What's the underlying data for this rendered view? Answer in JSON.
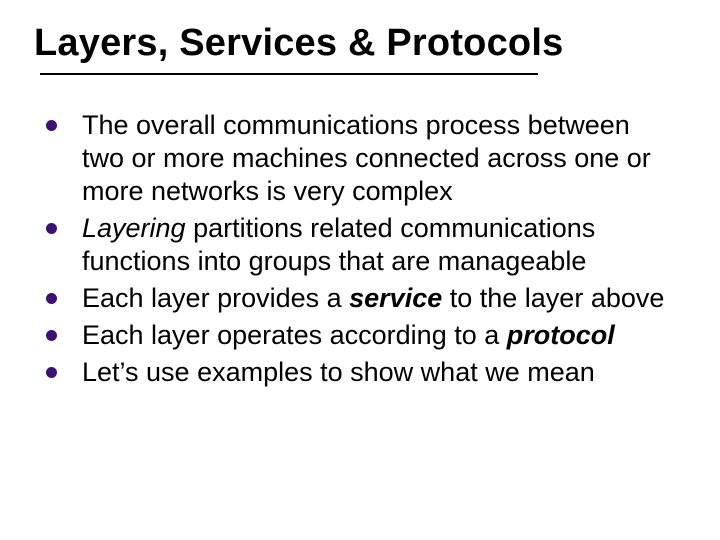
{
  "slide": {
    "title": "Layers, Services & Protocols",
    "bullets": [
      {
        "pre": "The overall communications process between two or more machines connected across one or more networks is very complex",
        "em": "",
        "post": ""
      },
      {
        "pre": "",
        "em": "Layering",
        "post": " partitions related communications functions into groups that are manageable"
      },
      {
        "pre": "Each layer provides a ",
        "em": "service",
        "post": " to the layer above"
      },
      {
        "pre": "Each layer operates according to a ",
        "em": "protocol",
        "post": ""
      },
      {
        "pre": "Let’s use examples to show what we mean",
        "em": "",
        "post": ""
      }
    ]
  }
}
